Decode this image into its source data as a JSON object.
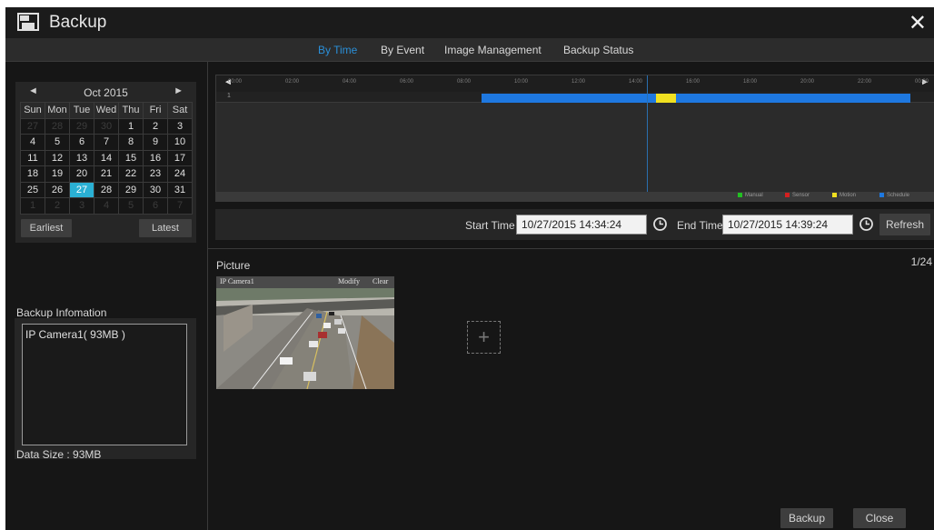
{
  "window": {
    "title": "Backup"
  },
  "tabs": [
    {
      "label": "By Time",
      "active": true
    },
    {
      "label": "By Event",
      "active": false
    },
    {
      "label": "Image Management",
      "active": false
    },
    {
      "label": "Backup Status",
      "active": false
    }
  ],
  "calendar": {
    "month_label": "Oct  2015",
    "weekdays": [
      "Sun",
      "Mon",
      "Tue",
      "Wed",
      "Thu",
      "Fri",
      "Sat"
    ],
    "weeks": [
      [
        "27",
        "28",
        "29",
        "30",
        "1",
        "2",
        "3"
      ],
      [
        "4",
        "5",
        "6",
        "7",
        "8",
        "9",
        "10"
      ],
      [
        "11",
        "12",
        "13",
        "14",
        "15",
        "16",
        "17"
      ],
      [
        "18",
        "19",
        "20",
        "21",
        "22",
        "23",
        "24"
      ],
      [
        "25",
        "26",
        "27",
        "28",
        "29",
        "30",
        "31"
      ],
      [
        "1",
        "2",
        "3",
        "4",
        "5",
        "6",
        "7"
      ]
    ],
    "selected_day": "27",
    "earliest_label": "Earliest",
    "latest_label": "Latest"
  },
  "backup_info": {
    "label": "Backup Infomation",
    "items": [
      "IP Camera1( 93MB )"
    ],
    "data_size": "Data Size : 93MB"
  },
  "timeline": {
    "ticks": [
      "00:00",
      "02:00",
      "04:00",
      "06:00",
      "08:00",
      "10:00",
      "12:00",
      "14:00",
      "16:00",
      "18:00",
      "20:00",
      "22:00",
      "00:00"
    ],
    "row_label": "1",
    "cursor_time": "14:36",
    "segments": [
      {
        "type": "schedule",
        "start_hour": 8.6,
        "end_hour": 14.7
      },
      {
        "type": "motion",
        "start_hour": 14.7,
        "end_hour": 15.4
      },
      {
        "type": "schedule",
        "start_hour": 15.4,
        "end_hour": 23.6
      }
    ],
    "legend": [
      {
        "label": "Manual",
        "color": "#22c022"
      },
      {
        "label": "Sensor",
        "color": "#d42020"
      },
      {
        "label": "Motion",
        "color": "#f0e020"
      },
      {
        "label": "Schedule",
        "color": "#1e78e0"
      }
    ]
  },
  "search": {
    "start_label": "Start Time",
    "start_value": "10/27/2015 14:34:24",
    "end_label": "End Time",
    "end_value": "10/27/2015 14:39:24",
    "refresh_label": "Refresh"
  },
  "picture": {
    "label": "Picture",
    "page": "1/24",
    "thumb_camera": "IP Camera1",
    "modify_label": "Modify",
    "clear_label": "Clear",
    "add_icon": "+"
  },
  "footer": {
    "backup_label": "Backup",
    "close_label": "Close"
  },
  "colors": {
    "accent": "#2a8fd8",
    "selected_day": "#2ab0d4",
    "schedule": "#1e78e0",
    "motion": "#f0e020"
  }
}
